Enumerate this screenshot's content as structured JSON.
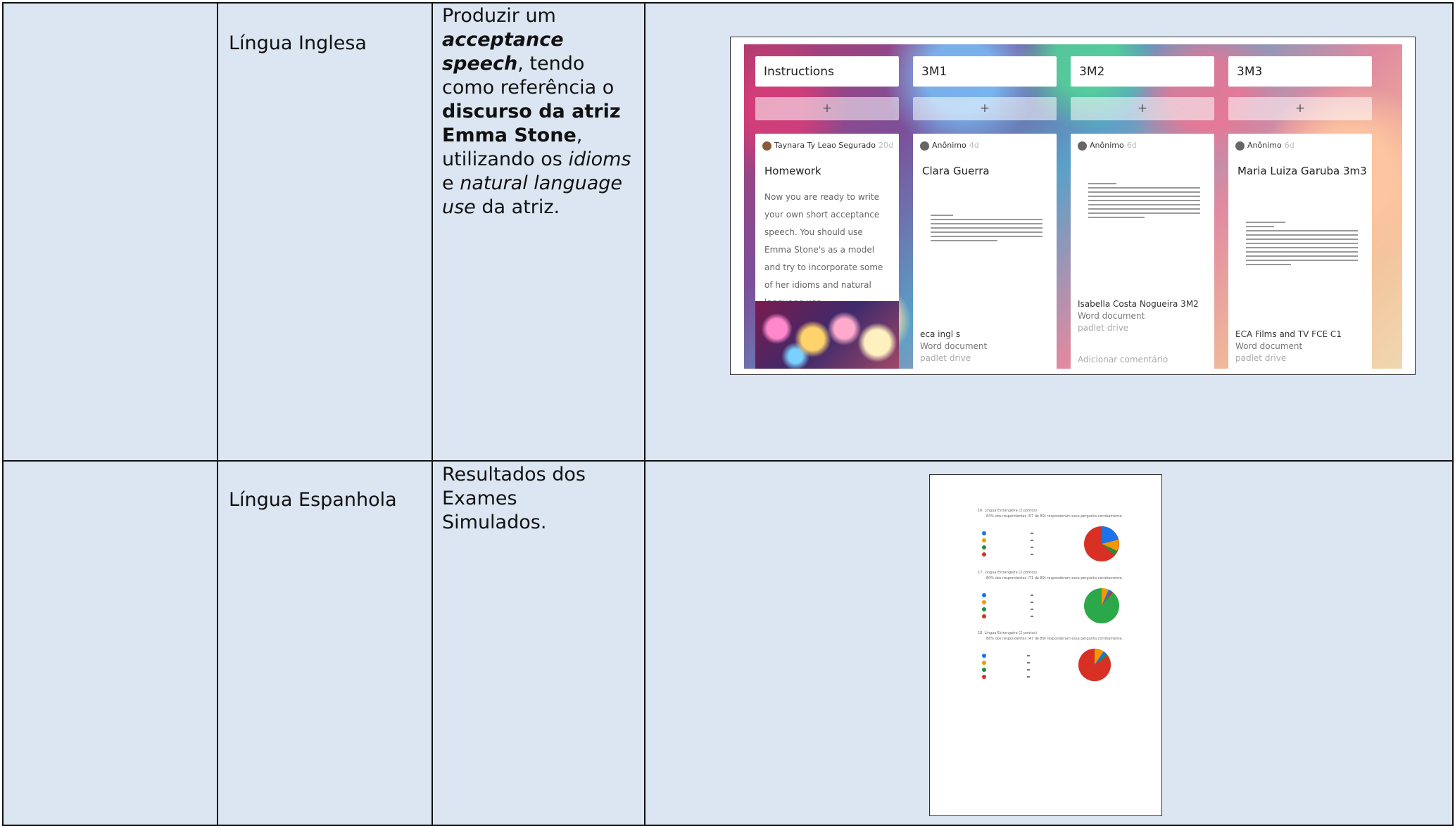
{
  "rows": [
    {
      "subject": "Língua Inglesa",
      "activity_parts": [
        {
          "text": "Produzir um ",
          "style": "normal"
        },
        {
          "text": "acceptance speech",
          "style": "bold-italic"
        },
        {
          "text": ", tendo como referência o ",
          "style": "normal"
        },
        {
          "text": "discurso da atriz Emma Stone",
          "style": "bold"
        },
        {
          "text": ", utilizando os ",
          "style": "normal"
        },
        {
          "text": "idioms",
          "style": "italic"
        },
        {
          "text": " e ",
          "style": "normal"
        },
        {
          "text": "natural language use",
          "style": "italic"
        },
        {
          "text": " da atriz.",
          "style": "normal"
        }
      ]
    },
    {
      "subject": "Língua Espanhola",
      "activity_parts": [
        {
          "text": "Resultados dos Exames Simulados.",
          "style": "normal"
        }
      ]
    }
  ],
  "padlet": {
    "columns": [
      {
        "title": "Instructions",
        "add": "+",
        "card": {
          "author": "Taynara Ty Leao Segurado",
          "age": "20d",
          "title": "Homework",
          "body": "Now you are ready to write your own short acceptance speech. You should use Emma Stone's as a model and try to incorporate some of her idioms and natural language use."
        }
      },
      {
        "title": "3M1",
        "add": "+",
        "card": {
          "author": "Anônimo",
          "age": "4d",
          "title": "Clara Guerra",
          "file_name": "eca ingl s",
          "file_type": "Word document",
          "file_source": "padlet drive"
        }
      },
      {
        "title": "3M2",
        "add": "+",
        "card": {
          "author": "Anônimo",
          "age": "6d",
          "title": "",
          "file_name": "Isabella Costa Nogueira 3M2",
          "file_type": "Word document",
          "file_source": "padlet drive",
          "comment": "Adicionar comentário"
        }
      },
      {
        "title": "3M3",
        "add": "+",
        "card": {
          "author": "Anônimo",
          "age": "6d",
          "title": "Maria Luiza Garuba 3m3",
          "file_name": "ECA Films and TV FCE C1",
          "file_type": "Word document",
          "file_source": "padlet drive"
        }
      }
    ]
  },
  "results": {
    "questions": [
      {
        "label": "16. Língua Estrangeira (2 pontos)",
        "sub": "64% dos respondentes (57 de 89) responderam essa pergunta corretamente.",
        "options": [
          "a",
          "b",
          "c",
          "d"
        ],
        "dominant_color": "#d93025"
      },
      {
        "label": "17. Língua Estrangeira (2 pontos)",
        "sub": "80% dos respondentes (71 de 89) responderam essa pergunta corretamente.",
        "options": [
          "a",
          "b",
          "c",
          "d"
        ],
        "dominant_color": "#2ba84a"
      },
      {
        "label": "18. Língua Estrangeira (2 pontos)",
        "sub": "88% dos respondentes (47 de 89) responderam essa pergunta corretamente.",
        "options": [
          "a",
          "b",
          "c",
          "d"
        ],
        "dominant_color": "#d93025"
      }
    ]
  }
}
